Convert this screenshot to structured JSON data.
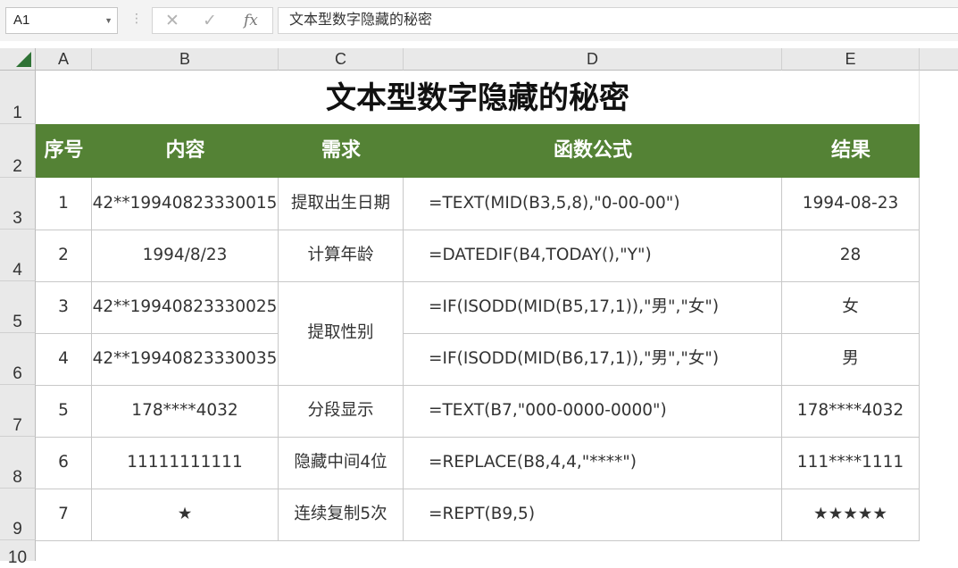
{
  "formula_bar": {
    "name_box": "A1",
    "cancel_icon": "✕",
    "enter_icon": "✓",
    "fx_label": "fx",
    "content": "文本型数字隐藏的秘密"
  },
  "columns": [
    "A",
    "B",
    "C",
    "D",
    "E"
  ],
  "rows": [
    "1",
    "2",
    "3",
    "4",
    "5",
    "6",
    "7",
    "8",
    "9",
    "10"
  ],
  "sheet": {
    "title": "文本型数字隐藏的秘密",
    "headers": [
      "序号",
      "内容",
      "需求",
      "函数公式",
      "结果"
    ],
    "data": [
      {
        "no": "1",
        "content": "42**19940823330015",
        "need": "提取出生日期",
        "formula": "=TEXT(MID(B3,5,8),\"0-00-00\")",
        "result": "1994-08-23"
      },
      {
        "no": "2",
        "content": "1994/8/23",
        "need": "计算年龄",
        "formula": "=DATEDIF(B4,TODAY(),\"Y\")",
        "result": "28"
      },
      {
        "no": "3",
        "content": "42**19940823330025",
        "need": "提取性别",
        "formula": "=IF(ISODD(MID(B5,17,1)),\"男\",\"女\")",
        "result": "女"
      },
      {
        "no": "4",
        "content": "42**19940823330035",
        "need": "",
        "formula": "=IF(ISODD(MID(B6,17,1)),\"男\",\"女\")",
        "result": "男"
      },
      {
        "no": "5",
        "content": "178****4032",
        "need": "分段显示",
        "formula": "=TEXT(B7,\"000-0000-0000\")",
        "result": "178****4032"
      },
      {
        "no": "6",
        "content": "11111111111",
        "need": "隐藏中间4位",
        "formula": "=REPLACE(B8,4,4,\"****\")",
        "result": "111****1111"
      },
      {
        "no": "7",
        "content": "★",
        "need": "连续复制5次",
        "formula": "=REPT(B9,5)",
        "result": "★★★★★"
      }
    ]
  },
  "colors": {
    "header_fill": "#548235",
    "header_text": "#ffffff",
    "select_all_triangle": "#2f7336"
  }
}
